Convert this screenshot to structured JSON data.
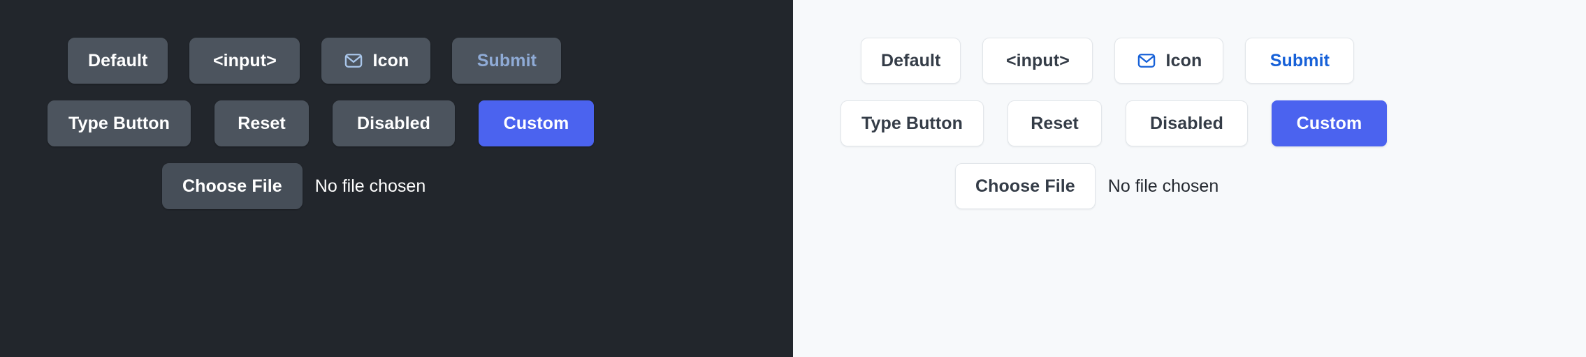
{
  "meta": {
    "colors": {
      "dark_panel_bg": "#22262c",
      "light_panel_bg": "#f7f9fb",
      "dark_button_bg": "#4c545e",
      "light_button_bg": "#ffffff",
      "light_button_border": "#e2e6ea",
      "accent_custom": "#4b63ef",
      "dark_submit_text": "#8fabd6",
      "light_submit_text": "#1761d8",
      "dark_text": "#ffffff",
      "light_text": "#343c47"
    }
  },
  "panels": [
    {
      "theme": "dark",
      "rows": [
        {
          "name": "row-primary",
          "buttons": [
            {
              "key": "default",
              "label": "Default",
              "icon": null
            },
            {
              "key": "input",
              "label": "<input>",
              "icon": null
            },
            {
              "key": "icon",
              "label": "Icon",
              "icon": "mail-icon"
            },
            {
              "key": "submit",
              "label": "Submit",
              "icon": null
            }
          ]
        },
        {
          "name": "row-secondary",
          "buttons": [
            {
              "key": "typebutton",
              "label": "Type Button",
              "icon": null
            },
            {
              "key": "reset",
              "label": "Reset",
              "icon": null
            },
            {
              "key": "disabled",
              "label": "Disabled",
              "icon": null
            },
            {
              "key": "custom",
              "label": "Custom",
              "icon": null
            }
          ]
        }
      ],
      "file": {
        "button_label": "Choose File",
        "status": "No file chosen"
      }
    },
    {
      "theme": "light",
      "rows": [
        {
          "name": "row-primary",
          "buttons": [
            {
              "key": "default",
              "label": "Default",
              "icon": null
            },
            {
              "key": "input",
              "label": "<input>",
              "icon": null
            },
            {
              "key": "icon",
              "label": "Icon",
              "icon": "mail-icon"
            },
            {
              "key": "submit",
              "label": "Submit",
              "icon": null
            }
          ]
        },
        {
          "name": "row-secondary",
          "buttons": [
            {
              "key": "typebutton",
              "label": "Type Button",
              "icon": null
            },
            {
              "key": "reset",
              "label": "Reset",
              "icon": null
            },
            {
              "key": "disabled",
              "label": "Disabled",
              "icon": null
            },
            {
              "key": "custom",
              "label": "Custom",
              "icon": null
            }
          ]
        }
      ],
      "file": {
        "button_label": "Choose File",
        "status": "No file chosen"
      }
    }
  ]
}
